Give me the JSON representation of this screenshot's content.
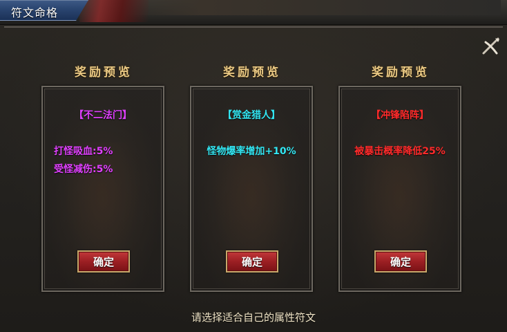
{
  "window": {
    "title": "符文命格"
  },
  "colors": {
    "purple": "#e040ff",
    "cyan": "#33e6f2",
    "red": "#ff2b2b",
    "gold_title": "#e9c883"
  },
  "cards": [
    {
      "preview_title": "奖励预览",
      "name": "【不二法门】",
      "attributes": [
        "打怪吸血:5%",
        "受怪减伤:5%"
      ],
      "button_label": "确定"
    },
    {
      "preview_title": "奖励预览",
      "name": "【赏金猎人】",
      "attributes": [
        "怪物爆率增加+10%"
      ],
      "button_label": "确定"
    },
    {
      "preview_title": "奖励预览",
      "name": "【冲锋陷阵】",
      "attributes": [
        "被暴击概率降低25%"
      ],
      "button_label": "确定"
    }
  ],
  "footer": {
    "tip": "请选择适合自己的属性符文"
  },
  "icons": {
    "close": "close-icon"
  }
}
